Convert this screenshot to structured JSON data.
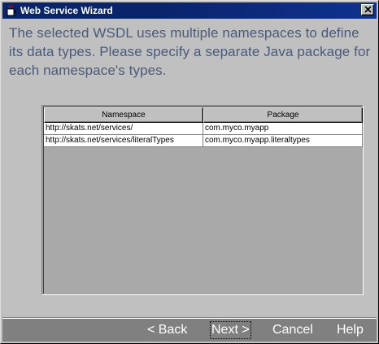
{
  "window": {
    "title": "Web Service Wizard"
  },
  "instructions": "The selected WSDL uses multiple namespaces to define its data types.  Please specify a separate Java package for each namespace's types.",
  "table": {
    "columns": [
      "Namespace",
      "Package"
    ],
    "rows": [
      {
        "namespace": "http://skats.net/services/",
        "package": "com.myco.myapp"
      },
      {
        "namespace": "http://skats.net/services/literalTypes",
        "package": "com.myco.myapp.literaltypes"
      }
    ]
  },
  "buttons": {
    "back": "< Back",
    "next": "Next >",
    "cancel": "Cancel",
    "help": "Help"
  },
  "icons": {
    "app": "java-cup-icon",
    "close": "close-icon"
  },
  "colors": {
    "titlebar": "#0a246a",
    "instructions_text": "#4a5a78",
    "button_bar": "#808080"
  }
}
